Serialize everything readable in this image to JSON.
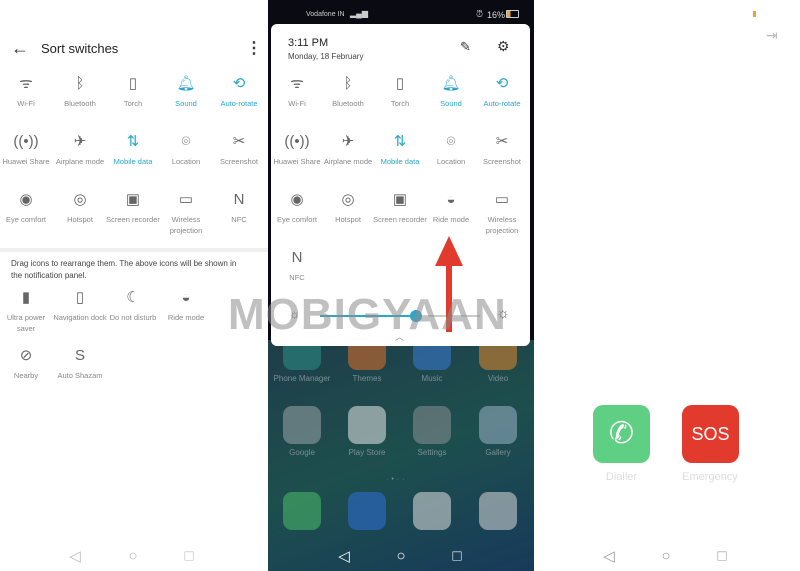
{
  "left": {
    "title": "Sort switches",
    "active_tiles": [
      {
        "label": "Wi-Fi",
        "icon": "wifi-icon",
        "glyph": "ᯤ",
        "on": false
      },
      {
        "label": "Bluetooth",
        "icon": "bluetooth-icon",
        "glyph": "ᛒ",
        "on": false
      },
      {
        "label": "Torch",
        "icon": "torch-icon",
        "glyph": "▯",
        "on": false
      },
      {
        "label": "Sound",
        "icon": "bell-icon",
        "glyph": "🔔︎",
        "on": true
      },
      {
        "label": "Auto-rotate",
        "icon": "auto-rotate-icon",
        "glyph": "⟲",
        "on": true
      },
      {
        "label": "Huawei Share",
        "icon": "huawei-share-icon",
        "glyph": "((•))",
        "on": false
      },
      {
        "label": "Airplane mode",
        "icon": "airplane-icon",
        "glyph": "✈",
        "on": false
      },
      {
        "label": "Mobile data",
        "icon": "mobile-data-icon",
        "glyph": "⇅",
        "on": true
      },
      {
        "label": "Location",
        "icon": "location-icon",
        "glyph": "⌾",
        "on": false
      },
      {
        "label": "Screenshot",
        "icon": "screenshot-icon",
        "glyph": "✂",
        "on": false
      },
      {
        "label": "Eye comfort",
        "icon": "eye-icon",
        "glyph": "◉",
        "on": false
      },
      {
        "label": "Hotspot",
        "icon": "hotspot-icon",
        "glyph": "◎",
        "on": false
      },
      {
        "label": "Screen recorder",
        "icon": "screen-recorder-icon",
        "glyph": "▣",
        "on": false
      },
      {
        "label": "Wireless projection",
        "icon": "wireless-projection-icon",
        "glyph": "▭",
        "on": false
      },
      {
        "label": "NFC",
        "icon": "nfc-icon",
        "glyph": "N",
        "on": false
      }
    ],
    "hint": "Drag icons to rearrange them. The above icons will be shown in the notification panel.",
    "inactive_tiles": [
      {
        "label": "Ultra power saver",
        "icon": "battery-icon",
        "glyph": "▮"
      },
      {
        "label": "Navigation dock",
        "icon": "navigation-dock-icon",
        "glyph": "▯"
      },
      {
        "label": "Do not disturb",
        "icon": "moon-icon",
        "glyph": "☾"
      },
      {
        "label": "Ride mode",
        "icon": "helmet-icon",
        "glyph": "◒"
      },
      {
        "label": "Nearby",
        "icon": "nearby-icon",
        "glyph": "⊘"
      },
      {
        "label": "Auto Shazam",
        "icon": "shazam-icon",
        "glyph": "S"
      }
    ]
  },
  "middle": {
    "status": {
      "carrier": "Vodafone IN",
      "battery": "16%"
    },
    "time": "3:11 PM",
    "date": "Monday, 18 February",
    "tiles": [
      {
        "label": "Wi-Fi",
        "icon": "wifi-icon",
        "glyph": "ᯤ",
        "on": false
      },
      {
        "label": "Bluetooth",
        "icon": "bluetooth-icon",
        "glyph": "ᛒ",
        "on": false
      },
      {
        "label": "Torch",
        "icon": "torch-icon",
        "glyph": "▯",
        "on": false
      },
      {
        "label": "Sound",
        "icon": "bell-icon",
        "glyph": "🔔︎",
        "on": true
      },
      {
        "label": "Auto-rotate",
        "icon": "auto-rotate-icon",
        "glyph": "⟲",
        "on": true
      },
      {
        "label": "Huawei Share",
        "icon": "huawei-share-icon",
        "glyph": "((•))",
        "on": false
      },
      {
        "label": "Airplane mode",
        "icon": "airplane-icon",
        "glyph": "✈",
        "on": false
      },
      {
        "label": "Mobile data",
        "icon": "mobile-data-icon",
        "glyph": "⇅",
        "on": true
      },
      {
        "label": "Location",
        "icon": "location-icon",
        "glyph": "⌾",
        "on": false
      },
      {
        "label": "Screenshot",
        "icon": "screenshot-icon",
        "glyph": "✂",
        "on": false
      },
      {
        "label": "Eye comfort",
        "icon": "eye-icon",
        "glyph": "◉",
        "on": false
      },
      {
        "label": "Hotspot",
        "icon": "hotspot-icon",
        "glyph": "◎",
        "on": false
      },
      {
        "label": "Screen recorder",
        "icon": "screen-recorder-icon",
        "glyph": "▣",
        "on": false
      },
      {
        "label": "Ride mode",
        "icon": "helmet-icon",
        "glyph": "◒",
        "on": false
      },
      {
        "label": "Wireless projection",
        "icon": "wireless-projection-icon",
        "glyph": "▭",
        "on": false
      },
      {
        "label": "NFC",
        "icon": "nfc-icon",
        "glyph": "N",
        "on": false
      }
    ],
    "brightness": 0.6,
    "apps": [
      {
        "label": "Phone Manager",
        "color": "#2d8f8a"
      },
      {
        "label": "Themes",
        "color": "#e0702a"
      },
      {
        "label": "Music",
        "color": "#3b7bd6"
      },
      {
        "label": "Video",
        "color": "#e2872b"
      },
      {
        "label": "Google",
        "color": "#9aa4a8"
      },
      {
        "label": "Play Store",
        "color": "#e8e8e8"
      },
      {
        "label": "Settings",
        "color": "#8a8f94"
      },
      {
        "label": "Gallery",
        "color": "#9ab2c8"
      }
    ],
    "dock": [
      {
        "color": "#4dbb6a"
      },
      {
        "color": "#2f6fd8"
      },
      {
        "color": "#e0e0e0"
      },
      {
        "color": "#d9d9d9"
      }
    ]
  },
  "right": {
    "dialler": "Dialler",
    "emergency": "Emergency",
    "sos": "SOS",
    "colors": {
      "dialler": "#5fcf83",
      "sos": "#e33a2e"
    }
  },
  "watermark": "MOBIGYAAN",
  "accent": "#2aa7c9"
}
